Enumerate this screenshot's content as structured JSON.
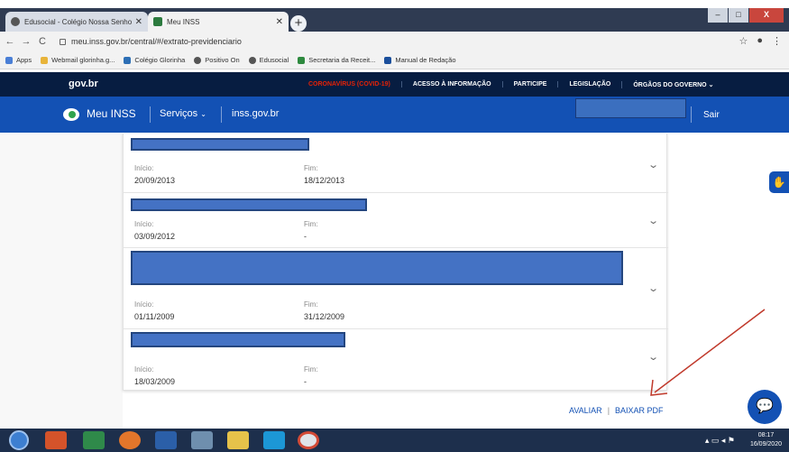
{
  "browser": {
    "tabs": [
      {
        "label": "Edusocial - Colégio Nossa Senhora",
        "active": false
      },
      {
        "label": "Meu INSS",
        "active": true
      }
    ],
    "url": "meu.inss.gov.br/central/#/extrato-previdenciario",
    "bookmarks": [
      "Apps",
      "Webmail glorinha.g...",
      "Colégio Glorinha",
      "Positivo On",
      "Edusocial",
      "Secretaria da Receit...",
      "Manual de Redação"
    ]
  },
  "govbar": {
    "logo": "gov.br",
    "links": [
      "CORONAVÍRUS (COVID-19)",
      "ACESSO À INFORMAÇÃO",
      "PARTICIPE",
      "LEGISLAÇÃO",
      "ÓRGÃOS DO GOVERNO"
    ]
  },
  "header": {
    "title": "Meu INSS",
    "menu": "Serviços",
    "site": "inss.gov.br",
    "logout": "Sair"
  },
  "records": [
    {
      "start_label": "Início:",
      "start": "20/09/2013",
      "end_label": "Fim:",
      "end": "18/12/2013"
    },
    {
      "start_label": "Início:",
      "start": "03/09/2012",
      "end_label": "Fim:",
      "end": "-"
    },
    {
      "start_label": "Início:",
      "start": "01/11/2009",
      "end_label": "Fim:",
      "end": "31/12/2009"
    },
    {
      "start_label": "Início:",
      "start": "18/03/2009",
      "end_label": "Fim:",
      "end": "-"
    }
  ],
  "actions": {
    "rate": "AVALIAR",
    "separator": "|",
    "download": "BAIXAR PDF"
  },
  "taskbar": {
    "time": "08:17",
    "date": "16/09/2020"
  },
  "colors": {
    "gov_navy": "#071d41",
    "inss_blue": "#1351b4",
    "alert_red": "#e52207",
    "redaction": "#4472c4"
  }
}
